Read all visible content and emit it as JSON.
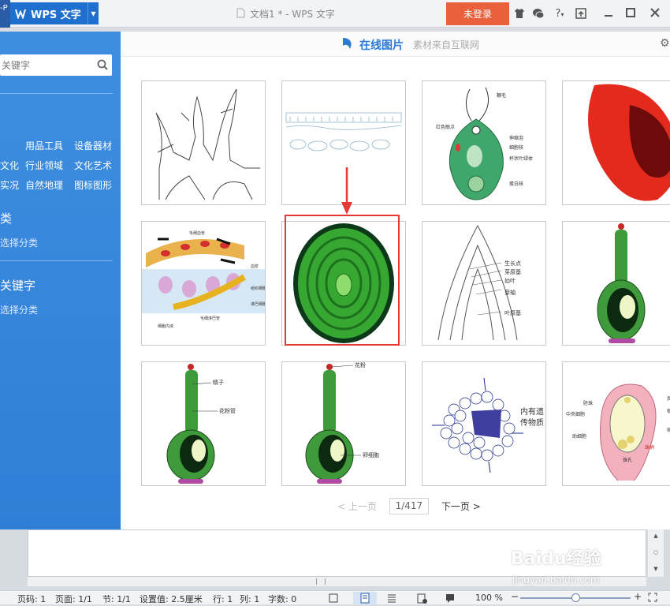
{
  "window": {
    "corner_text": "-P",
    "app_name": "WPS 文字",
    "doc_title": "文档1 * - WPS 文字",
    "login_label": "未登录",
    "icons": [
      "shirt-icon",
      "chat-icon",
      "help-icon",
      "restore-icon",
      "minimize-icon",
      "maximize-icon",
      "close-icon"
    ],
    "help_label": "?"
  },
  "sidebar": {
    "search_placeholder": "关键字",
    "rows": [
      [
        "用品工具",
        "设备器材"
      ],
      [
        "文化",
        "行业领域",
        "文化艺术"
      ],
      [
        "实况",
        "自然地理",
        "图标图形"
      ]
    ],
    "section1_title": "类",
    "section1_sub": "选择分类",
    "section2_title": "关键字",
    "section2_sub": "选择分类"
  },
  "dialog": {
    "title": "在线图片",
    "subtitle": "素材来自互联网",
    "thumbs": [
      {
        "name": "root-hair-line-drawing",
        "labels": []
      },
      {
        "name": "tissue-cross-section",
        "labels": []
      },
      {
        "name": "chlamydomonas",
        "labels": [
          "鞭毛",
          "伸缩泡",
          "红色眼点",
          "细胞核",
          "杯状叶绿体",
          "蛋白核"
        ]
      },
      {
        "name": "red-blood-cell",
        "labels": []
      },
      {
        "name": "capillary",
        "labels": [
          "毛细血管",
          "组织细胞",
          "淋巴细胞",
          "毛细淋巴管",
          "细胞内液",
          "血浆"
        ]
      },
      {
        "name": "green-oval-tissue",
        "labels": []
      },
      {
        "name": "shoot-tip",
        "labels": [
          "生长点",
          "芽原基",
          "幼叶",
          "芽轴",
          "叶原基"
        ]
      },
      {
        "name": "ovary-1",
        "labels": []
      },
      {
        "name": "ovary-2",
        "labels": [
          "精子",
          "花粉管"
        ]
      },
      {
        "name": "ovary-3",
        "labels": [
          "花粉",
          "卵细胞"
        ]
      },
      {
        "name": "cell-cluster",
        "labels": [
          "内有遗",
          "传物质"
        ]
      },
      {
        "name": "ovule",
        "labels": [
          "胚珠",
          "中央细胞",
          "助细胞",
          "珠孔",
          "珠柄",
          "反",
          "极",
          "卵"
        ]
      }
    ],
    "pager": {
      "prev": "< 上一页",
      "page": "1/417",
      "next": "下一页 >"
    }
  },
  "status": {
    "page_no": "页码: 1",
    "pages": "页面: 1/1",
    "section": "节: 1/1",
    "setting": "设置值: 2.5厘米",
    "row": "行: 1",
    "col": "列: 1",
    "words": "字数: 0",
    "zoom": "100 %"
  },
  "watermark": {
    "brand": "Baidu经验",
    "url": "jingyan.baidu.com"
  },
  "colors": {
    "accent": "#2b79d3",
    "login": "#e8613c",
    "selection": "#e53935",
    "sidebar": "#3485dc"
  }
}
